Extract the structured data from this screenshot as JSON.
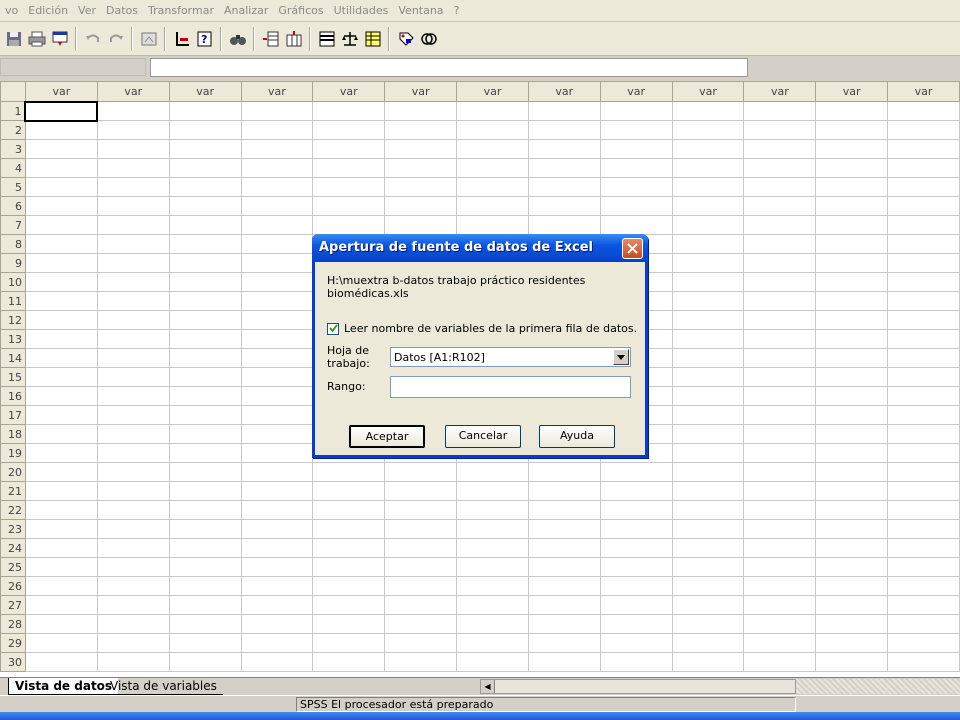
{
  "menu": [
    "vo",
    "Edición",
    "Ver",
    "Datos",
    "Transformar",
    "Analizar",
    "Gráficos",
    "Utilidades",
    "Ventana",
    "?"
  ],
  "toolbar": {
    "icons": [
      "save-icon",
      "print-icon",
      "dialog-recall-icon",
      "undo-icon",
      "redo-icon",
      "goto-chart-icon",
      "goto-case-icon",
      "variables-icon",
      "find-icon",
      "insert-case-icon",
      "insert-variable-icon",
      "split-file-icon",
      "weight-cases-icon",
      "select-cases-icon",
      "value-labels-icon",
      "use-sets-icon"
    ]
  },
  "grid": {
    "column_header": "var",
    "column_count": 13,
    "rows": [
      "1",
      "2",
      "3",
      "4",
      "5",
      "6",
      "7",
      "8",
      "9",
      "10",
      "11",
      "12",
      "13",
      "14",
      "15",
      "16",
      "17",
      "18",
      "19",
      "20",
      "21",
      "22",
      "23",
      "24",
      "25",
      "26",
      "27",
      "28",
      "29",
      "30"
    ]
  },
  "tabs": {
    "data_view": "Vista de datos",
    "variable_view": "Vista de variables"
  },
  "status": "SPSS El procesador  está preparado",
  "dialog": {
    "title": "Apertura de fuente de datos de Excel",
    "path_line1": "H:\\muextra b-datos trabajo práctico residentes",
    "path_line2": "biomédicas.xls",
    "checkbox_label": "Leer nombre de variables de la primera fila de datos.",
    "checkbox_checked": true,
    "worksheet_label_line1": "Hoja de",
    "worksheet_label_line2": "trabajo:",
    "worksheet_value": "Datos  [A1:R102]",
    "range_label": "Rango:",
    "range_value": "",
    "buttons": {
      "ok": "Aceptar",
      "cancel": "Cancelar",
      "help": "Ayuda"
    }
  }
}
